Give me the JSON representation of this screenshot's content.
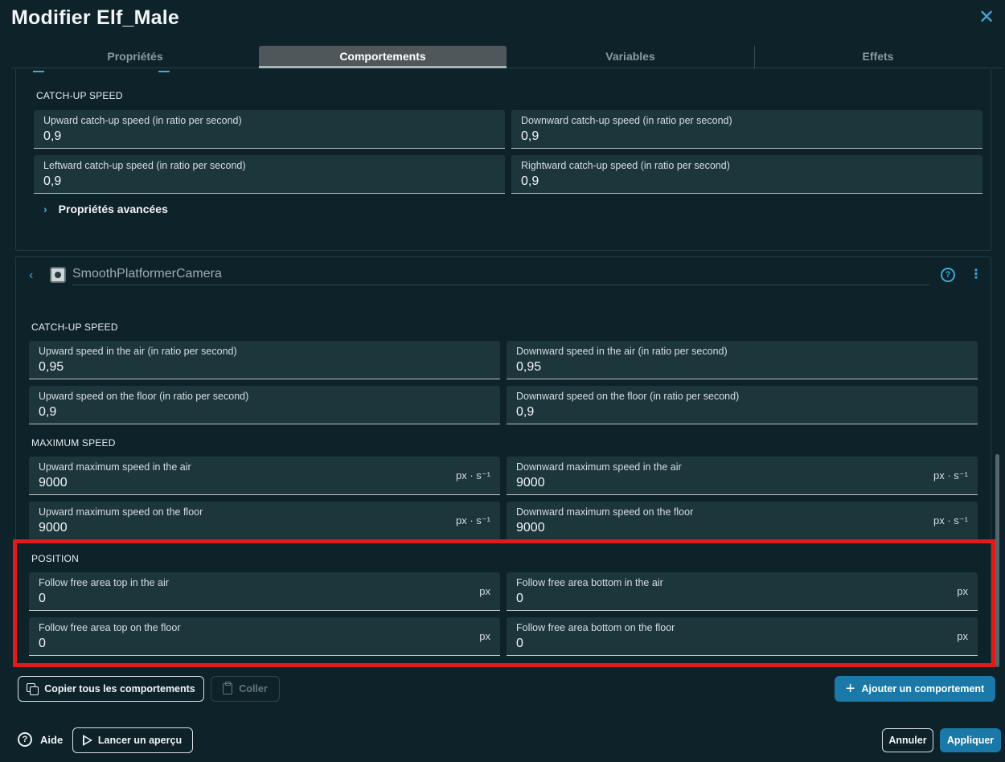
{
  "dialog": {
    "title": "Modifier Elf_Male"
  },
  "tabs": [
    {
      "label": "Propriétés"
    },
    {
      "label": "Comportements"
    },
    {
      "label": "Variables"
    },
    {
      "label": "Effets"
    }
  ],
  "card1": {
    "section": "CATCH-UP SPEED",
    "fields": [
      {
        "label": "Upward catch-up speed (in ratio per second)",
        "value": "0,9"
      },
      {
        "label": "Downward catch-up speed (in ratio per second)",
        "value": "0,9"
      },
      {
        "label": "Leftward catch-up speed (in ratio per second)",
        "value": "0,9"
      },
      {
        "label": "Rightward catch-up speed (in ratio per second)",
        "value": "0,9"
      }
    ],
    "advanced": "Propriétés avancées"
  },
  "behavior": {
    "name": "SmoothPlatformerCamera",
    "help_icon": "help-icon",
    "more_icon": "more-vertical-icon",
    "catchup_section": "CATCH-UP SPEED",
    "catchup": [
      {
        "label": "Upward speed in the air (in ratio per second)",
        "value": "0,95"
      },
      {
        "label": "Downward speed in the air (in ratio per second)",
        "value": "0,95"
      },
      {
        "label": "Upward speed on the floor (in ratio per second)",
        "value": "0,9"
      },
      {
        "label": "Downward speed on the floor (in ratio per second)",
        "value": "0,9"
      }
    ],
    "maxspeed_section": "MAXIMUM SPEED",
    "maxspeed": [
      {
        "label": "Upward maximum speed in the air",
        "value": "9000",
        "unit": "px · s⁻¹"
      },
      {
        "label": "Downward maximum speed in the air",
        "value": "9000",
        "unit": "px · s⁻¹"
      },
      {
        "label": "Upward maximum speed on the floor",
        "value": "9000",
        "unit": "px · s⁻¹"
      },
      {
        "label": "Downward maximum speed on the floor",
        "value": "9000",
        "unit": "px · s⁻¹"
      }
    ],
    "position_section": "POSITION",
    "position": [
      {
        "label": "Follow free area top in the air",
        "value": "0",
        "unit": "px"
      },
      {
        "label": "Follow free area bottom in the air",
        "value": "0",
        "unit": "px"
      },
      {
        "label": "Follow free area top on the floor",
        "value": "0",
        "unit": "px"
      },
      {
        "label": "Follow free area bottom on the floor",
        "value": "0",
        "unit": "px"
      }
    ]
  },
  "actions": {
    "copy_all": "Copier tous les comportements",
    "paste": "Coller",
    "add_behavior": "Ajouter un comportement"
  },
  "footer": {
    "help": "Aide",
    "preview": "Lancer un aperçu",
    "cancel": "Annuler",
    "apply": "Appliquer"
  },
  "colors": {
    "background": "#0e2229",
    "field": "#1c363c",
    "accent": "#3fa9d9",
    "primary": "#1a79a8",
    "highlight": "#e01b1b"
  }
}
